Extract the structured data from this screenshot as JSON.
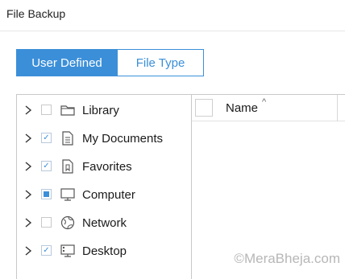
{
  "window": {
    "title": "File Backup"
  },
  "tabs": [
    {
      "label": "User Defined",
      "active": true
    },
    {
      "label": "File Type",
      "active": false
    }
  ],
  "tree": {
    "items": [
      {
        "label": "Library",
        "check_state": "unchecked",
        "icon": "folder-icon"
      },
      {
        "label": "My Documents",
        "check_state": "checked",
        "icon": "document-icon"
      },
      {
        "label": "Favorites",
        "check_state": "checked",
        "icon": "favorites-icon"
      },
      {
        "label": "Computer",
        "check_state": "partial",
        "icon": "monitor-icon"
      },
      {
        "label": "Network",
        "check_state": "unchecked",
        "icon": "network-icon"
      },
      {
        "label": "Desktop",
        "check_state": "checked",
        "icon": "desktop-icon"
      }
    ]
  },
  "file_list": {
    "columns": [
      {
        "label": "Name",
        "sort": "ascending"
      }
    ]
  },
  "watermark": "©MeraBheja.com",
  "colors": {
    "accent": "#3b8fd9",
    "border": "#c9c9c9"
  }
}
